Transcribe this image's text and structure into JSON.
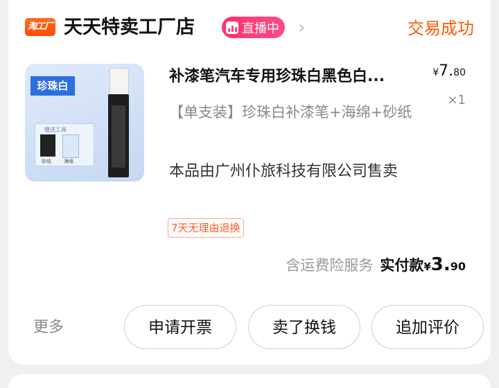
{
  "header": {
    "shop_logo_text": "淘工厂",
    "shop_name": "天天特卖工厂店",
    "live_badge": "直播中",
    "order_status": "交易成功"
  },
  "product": {
    "image_tag": "珍珠白",
    "image_box_title": "赠送工具",
    "image_swatch_labels": [
      "砂纸",
      "海绵"
    ],
    "title": "补漆笔汽车专用珍珠白黑色白...",
    "price_currency": "¥",
    "price_int": "7.",
    "price_dec": "80",
    "quantity": "×1",
    "sku": "【单支装】珍珠白补漆笔+海绵+砂纸",
    "seller_note": "本品由广州仆旅科技有限公司售卖",
    "return_policy": "7天无理由退换"
  },
  "totals": {
    "shipping_note": "含运费险服务",
    "paid_label": "实付款",
    "paid_currency": "¥",
    "paid_int": "3.",
    "paid_dec": "90"
  },
  "footer": {
    "more_label": "更多",
    "buttons": [
      "申请开票",
      "卖了换钱",
      "追加评价"
    ]
  },
  "colors": {
    "accent_orange": "#ff5a00",
    "live_pink": "#ff3a78",
    "page_bg": "#f0f0f0"
  }
}
